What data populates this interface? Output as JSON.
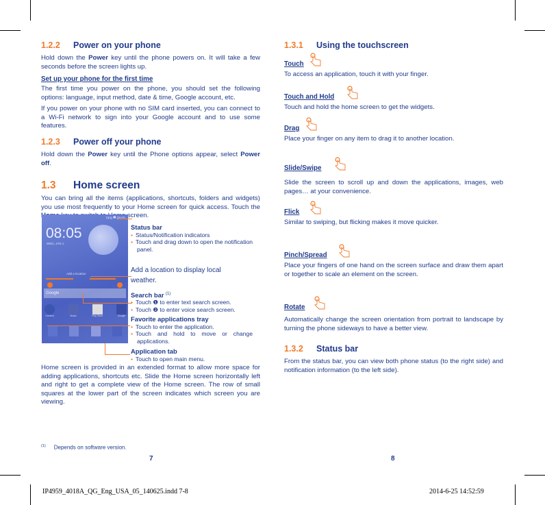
{
  "left": {
    "s122": {
      "num": "1.2.2",
      "title": "Power on your phone"
    },
    "p1a": "Hold down the ",
    "p1b": "Power",
    "p1c": " key until the phone powers on. It will take a few seconds before the screen lights up.",
    "setup": "Set up your phone for the first time",
    "p2": "The first time you power on the phone, you should set the following options: language, input method, date & time, Google account, etc.",
    "p3": "If you power on your phone with no SIM card inserted, you can connect to a Wi-Fi network to sign into your Google account and to use some features.",
    "s123": {
      "num": "1.2.3",
      "title": "Power off your phone"
    },
    "p4a": "Hold down the ",
    "p4b": "Power",
    "p4c": " key until the Phone options appear, select ",
    "p4d": "Power off",
    "p4e": ".",
    "s13": {
      "num": "1.3",
      "title": "Home screen"
    },
    "p5a": "You can bring all the items (applications, shortcuts, folders and widgets) you use most frequently to your Home screen for quick access. Touch the ",
    "p5b": "Home",
    "p5c": " key to switch to Home screen.",
    "phone": {
      "status": "74%  ▀ 08:05",
      "clock": "08:05",
      "date": "WED, JAN 1",
      "location": "Add a location",
      "search": "Google",
      "apps": [
        "Camera",
        "Music",
        "Play Store",
        "Google"
      ]
    },
    "callouts": {
      "status_title": "Status bar",
      "status_items": [
        "Status/Notification indicators",
        "Touch and drag down to open the notification panel."
      ],
      "weather": "Add a location to display local weather.",
      "search_title": "Search bar",
      "search_sup": "(1)",
      "search_items": [
        "Touch ❶ to enter text search screen.",
        "Touch ❷ to enter voice search screen."
      ],
      "fav_title": "Favorite applications tray",
      "fav_items": [
        "Touch to enter the application.",
        "Touch and hold to move or change applications."
      ],
      "app_title": "Application tab",
      "app_items": [
        "Touch to open main menu."
      ]
    },
    "p6": "Home screen is provided in an extended format to allow more space for adding applications, shortcuts etc. Slide the Home screen horizontally left and right to get a complete view of the Home screen. The row of small squares at the lower part of the screen indicates which screen you are viewing.",
    "footnote_mark": "(1)",
    "footnote": "Depends on software version.",
    "page": "7"
  },
  "right": {
    "s131": {
      "num": "1.3.1",
      "title": "Using the touchscreen"
    },
    "items": [
      {
        "label": "Touch",
        "text": "To access an application, touch it with your finger."
      },
      {
        "label": "Touch and Hold",
        "text": "Touch and hold the home screen to get the widgets."
      },
      {
        "label": "Drag",
        "text": "Place your finger on any item to drag it to another location."
      },
      {
        "label": "Slide/Swipe",
        "text": "Slide the screen to scroll up and down the applications, images, web pages… at your convenience."
      },
      {
        "label": "Flick",
        "text": "Similar to swiping, but flicking makes it move quicker."
      },
      {
        "label": "Pinch/Spread",
        "text": "Place your fingers of one hand on the screen surface and draw them apart or together to scale an element on the screen."
      },
      {
        "label": "Rotate",
        "text": "Automatically change the screen orientation from portrait to landscape by turning the phone sideways to have a better view."
      }
    ],
    "s132": {
      "num": "1.3.2",
      "title": "Status bar"
    },
    "p_status": "From the status bar, you can view both phone status (to the right side) and notification information (to the left side).",
    "page": "8"
  },
  "slug": {
    "file": "IP4959_4018A_QG_Eng_USA_05_140625.indd   7-8",
    "date": "2014-6-25   14:52:59"
  },
  "colors": {
    "text": "#1f3a8a",
    "accent": "#f07a2a"
  }
}
